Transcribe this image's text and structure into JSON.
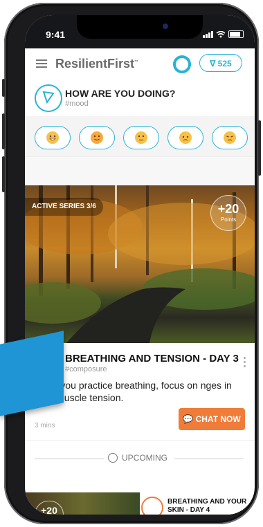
{
  "status": {
    "time": "9:41"
  },
  "app": {
    "brand": "ResilientFirst",
    "brand_mark": "™",
    "points": "525"
  },
  "mood": {
    "title": "HOW ARE YOU DOING?",
    "tag": "#mood",
    "faces": [
      "grinning-face",
      "smiling-face",
      "neutral-face",
      "worried-face",
      "frustrated-face"
    ]
  },
  "hero": {
    "series": "ACTIVE SERIES 3/6",
    "points_value": "+20",
    "points_label": "Points"
  },
  "card": {
    "title": "BREATHING AND TENSION - DAY 3",
    "tag": "#composure",
    "body": "ay as you practice breathing, focus on nges in your muscle tension.",
    "duration": "3 mins",
    "chat": "CHAT NOW"
  },
  "upcoming": {
    "label": "UPCOMING"
  },
  "next": {
    "points": "+20",
    "title": "BREATHING AND YOUR SKIN - DAY 4"
  },
  "colors": {
    "accent": "#27b3d6",
    "orange": "#f07c3a"
  }
}
